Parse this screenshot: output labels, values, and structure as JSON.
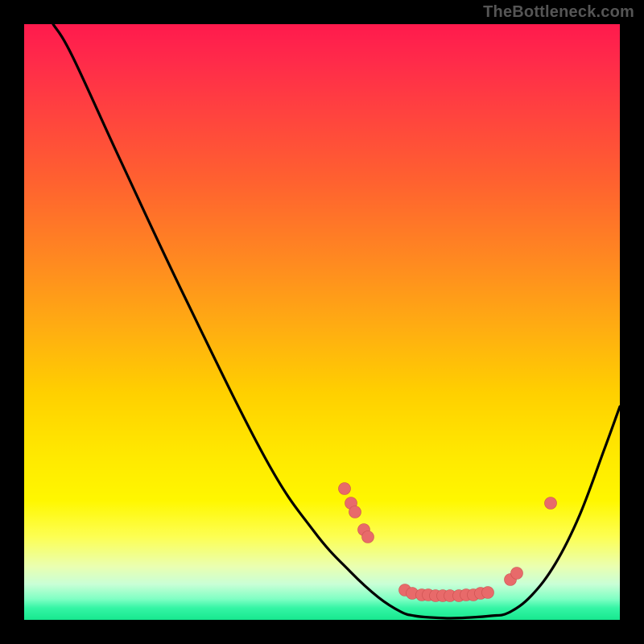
{
  "watermark": "TheBottleneck.com",
  "chart_data": {
    "type": "line",
    "title": "",
    "xlabel": "",
    "ylabel": "",
    "xlim": [
      0,
      740
    ],
    "ylim": [
      0,
      740
    ],
    "curve": {
      "description": "V-shaped bottleneck curve; x is normalized component index, y is mismatch percentage (0 at bottom, ~100 at top).",
      "left_branch": [
        [
          36,
          0
        ],
        [
          60,
          40
        ],
        [
          120,
          170
        ],
        [
          200,
          340
        ],
        [
          300,
          540
        ],
        [
          360,
          630
        ],
        [
          405,
          680
        ],
        [
          440,
          712
        ],
        [
          468,
          730
        ]
      ],
      "valley_floor": [
        [
          468,
          730
        ],
        [
          485,
          735
        ],
        [
          505,
          737
        ],
        [
          530,
          738
        ],
        [
          555,
          737
        ],
        [
          580,
          735
        ],
        [
          602,
          731
        ]
      ],
      "right_branch": [
        [
          602,
          731
        ],
        [
          630,
          710
        ],
        [
          660,
          670
        ],
        [
          690,
          610
        ],
        [
          720,
          530
        ],
        [
          740,
          475
        ]
      ]
    },
    "markers": [
      {
        "x": 398,
        "y": 577
      },
      {
        "x": 406,
        "y": 595
      },
      {
        "x": 411,
        "y": 606
      },
      {
        "x": 422,
        "y": 628
      },
      {
        "x": 427,
        "y": 637
      },
      {
        "x": 473,
        "y": 703
      },
      {
        "x": 482,
        "y": 707
      },
      {
        "x": 494,
        "y": 709
      },
      {
        "x": 502,
        "y": 709
      },
      {
        "x": 511,
        "y": 710
      },
      {
        "x": 520,
        "y": 710
      },
      {
        "x": 529,
        "y": 710
      },
      {
        "x": 540,
        "y": 710
      },
      {
        "x": 549,
        "y": 709
      },
      {
        "x": 558,
        "y": 709
      },
      {
        "x": 567,
        "y": 707
      },
      {
        "x": 576,
        "y": 706
      },
      {
        "x": 604,
        "y": 690
      },
      {
        "x": 612,
        "y": 682
      },
      {
        "x": 654,
        "y": 595
      }
    ],
    "gradient_scale": {
      "top_color": "#ff1a4d",
      "bottom_color": "#17e88f",
      "meaning": "red = high bottleneck, green = balanced"
    }
  }
}
